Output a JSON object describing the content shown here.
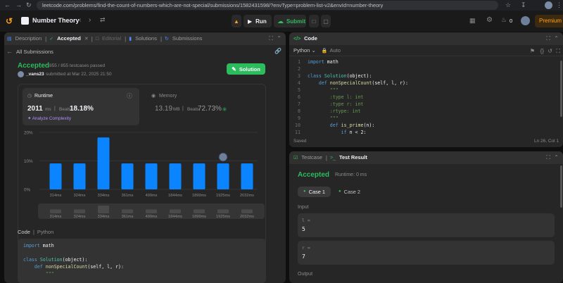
{
  "browser": {
    "url": "leetcode.com/problems/find-the-count-of-numbers-which-are-not-special/submissions/1582431598/?envType=problem-list-v2&envId=number-theory"
  },
  "header": {
    "problem_list": "Number Theory",
    "run_label": "Run",
    "submit_label": "Submit",
    "streak_count": "0",
    "premium_label": "Premium"
  },
  "left_tabs": [
    "Description",
    "Accepted",
    "Editorial",
    "Solutions",
    "Submissions"
  ],
  "submission": {
    "back_label": "All Submissions",
    "status": "Accepted",
    "testcases": "855 / 855 testcases passed",
    "user": "_vans23",
    "submitted_text": "submitted at Mar 22, 2025 21:50",
    "solution_button": "Solution",
    "runtime_label": "Runtime",
    "runtime_value": "2011",
    "runtime_unit": "ms",
    "beats_label": "Beats",
    "runtime_beats": "18.18%",
    "analyze_label": "Analyze Complexity",
    "memory_label": "Memory",
    "memory_value": "13.19",
    "memory_unit": "MB",
    "memory_beats": "72.73%"
  },
  "chart_data": {
    "type": "bar",
    "categories": [
      "314ms",
      "324ms",
      "334ms",
      "361ms",
      "499ms",
      "1844ms",
      "1899ms",
      "1925ms",
      "2032ms"
    ],
    "values": [
      9.1,
      9.1,
      18.2,
      9.1,
      9.1,
      9.1,
      9.1,
      9.1,
      9.1
    ],
    "yticks": [
      "20%",
      "10%",
      "0%"
    ],
    "ylim": [
      0,
      20
    ],
    "highlight": "1925ms",
    "bar_color": "#0a84ff"
  },
  "code_section": {
    "label": "Code",
    "language": "Python",
    "lines": [
      "import math",
      "",
      "class Solution(object):",
      "    def nonSpecialCount(self, l, r):",
      "        \"\"\""
    ]
  },
  "editor": {
    "title": "Code",
    "language": "Python",
    "mode": "Auto",
    "saved": "Saved",
    "position": "Ln 26, Col 1",
    "lines": [
      {
        "n": "1",
        "t": "import math"
      },
      {
        "n": "2",
        "t": ""
      },
      {
        "n": "3",
        "t": "class Solution(object):"
      },
      {
        "n": "4",
        "t": "    def nonSpecialCount(self, l, r):"
      },
      {
        "n": "5",
        "t": "        \"\"\""
      },
      {
        "n": "6",
        "t": "        :type l: int"
      },
      {
        "n": "7",
        "t": "        :type r: int"
      },
      {
        "n": "8",
        "t": "        :rtype: int"
      },
      {
        "n": "9",
        "t": "        \"\"\""
      },
      {
        "n": "10",
        "t": "        def is_prime(n):"
      },
      {
        "n": "11",
        "t": "            if n < 2:"
      }
    ]
  },
  "result": {
    "tab_testcase": "Testcase",
    "tab_result": "Test Result",
    "status": "Accepted",
    "runtime": "Runtime: 0 ms",
    "case1": "Case 1",
    "case2": "Case 2",
    "input_label": "Input",
    "var1_name": "l =",
    "var1_value": "5",
    "var2_name": "r =",
    "var2_value": "7",
    "output_label": "Output"
  }
}
